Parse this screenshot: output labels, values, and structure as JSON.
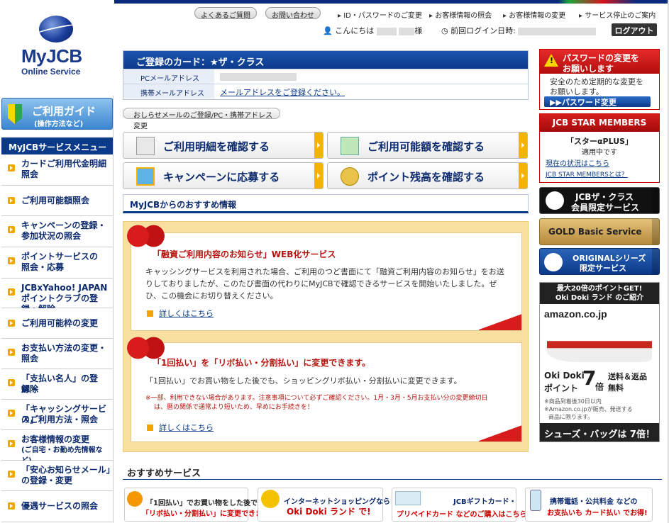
{
  "logo": {
    "title": "MyJCB",
    "subtitle": "Online Service"
  },
  "guide": {
    "title": "ご利用ガイド",
    "sub": "(操作方法など)"
  },
  "left_menu": {
    "header": "MyJCBサービスメニュー",
    "items": [
      {
        "l1": "カードご利用代金明細",
        "l2": "照会"
      },
      {
        "l1": "ご利用可能額照会",
        "l2": ""
      },
      {
        "l1": "キャンペーンの登録・",
        "l2": "参加状況の照会"
      },
      {
        "l1": "ポイントサービスの",
        "l2": "照会・応募"
      },
      {
        "l1": "JCBxYahoo! JAPAN",
        "l2": "ポイントクラブの登録・解除"
      },
      {
        "l1": "ご利用可能枠の変更",
        "l2": ""
      },
      {
        "l1": "お支払い方法の変更・",
        "l2": "照会"
      },
      {
        "l1": "「支払い名人」の登録・",
        "l2": "解除"
      },
      {
        "l1": "「キャッシングサービス」",
        "l2": "のご利用方法・照会"
      },
      {
        "l1": "お客様情報の変更",
        "l2": "(ご自宅・お勤め先情報など)"
      },
      {
        "l1": "「安心お知らせメール」",
        "l2": "の登録・変更"
      },
      {
        "l1": "優遇サービスの照会",
        "l2": ""
      }
    ]
  },
  "top_nav": {
    "faq": "よくあるご質問",
    "contact": "お問い合わせ",
    "links": [
      "ID・パスワードのご変更",
      "お客様情報の照会",
      "お客様情報の変更",
      "サービス停止のご案内"
    ]
  },
  "user": {
    "greeting": "こんにちは",
    "honorific": "様",
    "last_login_label": "前回ログイン日時:",
    "logout": "ログアウト"
  },
  "card": {
    "title": "ご登録のカード：★ザ・クラス",
    "pc_mail_label": "PCメールアドレス",
    "mobile_mail_label": "携帯メールアドレス",
    "mobile_mail_link": "メールアドレスをご登録ください。"
  },
  "oshirase_link": "おしらせメールのご登録/PC・携帯アドレス変更",
  "main_buttons": [
    "ご利用明細を確認する",
    "ご利用可能額を確認する",
    "キャンペーンに応募する",
    "ポイント残高を確認する"
  ],
  "recommend": {
    "header": "MyJCBからのおすすめ情報",
    "items": [
      {
        "title": "「融資ご利用内容のお知らせ」WEB化サービス",
        "body": "キャッシングサービスを利用された場合、ご利用のつど書面にて「融資ご利用内容のお知らせ」をお送りしておりましたが、このたび書面の代わりにMyJCBで確認できるサービスを開始いたしました。ぜひ、この機会にお切り替えください。",
        "note1": "",
        "note2": "",
        "link": "詳しくはこちら"
      },
      {
        "title": "「1回払い」を「リボ払い・分割払い」に変更できます。",
        "body": "「1回払い」でお買い物をした後でも、ショッピングリボ払い・分割払いに変更できます。",
        "note1": "※一部、利用できない場合があります。注意事項について必ずご確認ください。1月・3月・5月お支払い分の変更締切日",
        "note2": "は、暦の関係で通常より短いため、早めにお手続きを！",
        "link": "詳しくはこちら"
      }
    ]
  },
  "osusume": {
    "header": "おすすめサービス",
    "banners": [
      {
        "l1": "「1回払い」でお買い物をした後でも",
        "l2": "「リボ払い・分割払い」に変更できます!"
      },
      {
        "l1": "インターネットショッピングなら",
        "l2": "Oki Doki ランド で!"
      },
      {
        "l1": "JCBギフトカード・",
        "l2": "プリペイドカード などのご購入はこちら"
      },
      {
        "l1": "携帯電話・公共料金 などの",
        "l2": "お支払いも カード払い でお得!"
      }
    ]
  },
  "right": {
    "pw": {
      "title1": "パスワードの変更を",
      "title2": "お願いします",
      "body1": "安全のため定期的な変更を",
      "body2": "お願いします。",
      "button": "▶▶パスワード変更"
    },
    "star": {
      "header": "JCB STAR MEMBERS",
      "rank": "「スターαPLUS」",
      "applied": "適用中です",
      "link1": "現在の状況はこちら",
      "link2": "JCB STAR MEMBERSとは？"
    },
    "theclass": {
      "l1": "JCBザ・クラス",
      "l2": "会員限定サービス"
    },
    "gold": "GOLD Basic Service",
    "original": {
      "l1": "ORIGINALシリーズ",
      "l2": "限定サービス"
    },
    "amazon": {
      "head1": "最大20倍のポイントGET!",
      "head2": "Oki Doki ランド のご紹介",
      "brand": "amazon.co.jp",
      "pt1": "Oki Doki",
      "pt2": "ポイント",
      "times": "7",
      "bai": "倍",
      "ship1": "送料＆返品",
      "ship2": "無料",
      "note1": "※商品到着後30日以内",
      "note2": "※Amazon.co.jpが販売、発送する",
      "note3": "商品に限ります。",
      "foot": "シューズ・バッグは 7倍！"
    }
  },
  "colors": {
    "navy": "#0c3a8a",
    "red": "#c00000",
    "orange": "#f0a500",
    "gold": "#f9e0a0"
  }
}
